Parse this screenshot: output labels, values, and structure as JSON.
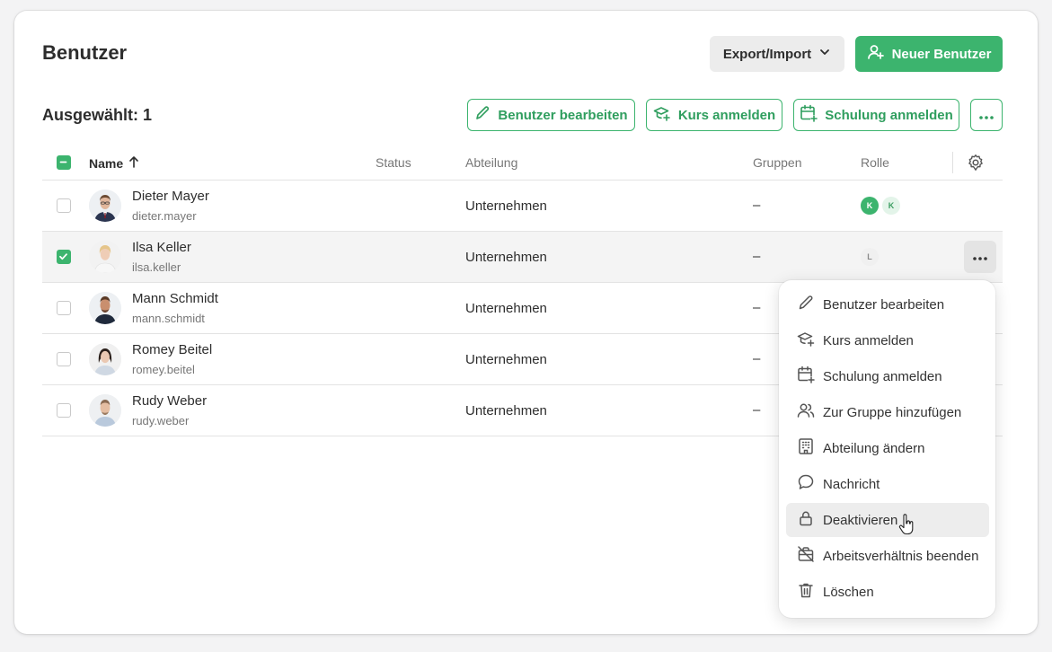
{
  "page": {
    "title": "Benutzer"
  },
  "toolbar": {
    "export_import": "Export/Import",
    "new_user": "Neuer Benutzer"
  },
  "selection": {
    "label": "Ausgewählt: 1",
    "actions": {
      "edit_user": "Benutzer bearbeiten",
      "enroll_course": "Kurs anmelden",
      "enroll_training": "Schulung anmelden"
    }
  },
  "table": {
    "columns": {
      "name": "Name",
      "status": "Status",
      "department": "Abteilung",
      "groups": "Gruppen",
      "role": "Rolle"
    },
    "rows": [
      {
        "name": "Dieter Mayer",
        "login": "dieter.mayer",
        "department": "Unternehmen",
        "groups": "–",
        "roles": [
          "K",
          "K"
        ],
        "selected": false
      },
      {
        "name": "Ilsa Keller",
        "login": "ilsa.keller",
        "department": "Unternehmen",
        "groups": "–",
        "roles": [
          "L"
        ],
        "selected": true
      },
      {
        "name": "Mann Schmidt",
        "login": "mann.schmidt",
        "department": "Unternehmen",
        "groups": "–",
        "roles": [],
        "selected": false
      },
      {
        "name": "Romey Beitel",
        "login": "romey.beitel",
        "department": "Unternehmen",
        "groups": "–",
        "roles": [],
        "selected": false
      },
      {
        "name": "Rudy Weber",
        "login": "rudy.weber",
        "department": "Unternehmen",
        "groups": "–",
        "roles": [],
        "selected": false
      }
    ]
  },
  "context_menu": {
    "items": [
      {
        "label": "Benutzer bearbeiten",
        "icon": "pencil-icon"
      },
      {
        "label": "Kurs anmelden",
        "icon": "graduation-cap-plus-icon"
      },
      {
        "label": "Schulung anmelden",
        "icon": "calendar-plus-icon"
      },
      {
        "label": "Zur Gruppe hinzufügen",
        "icon": "users-icon"
      },
      {
        "label": "Abteilung ändern",
        "icon": "building-icon"
      },
      {
        "label": "Nachricht",
        "icon": "chat-bubble-icon"
      },
      {
        "label": "Deaktivieren",
        "icon": "lock-icon"
      },
      {
        "label": "Arbeitsverhältnis beenden",
        "icon": "briefcase-off-icon"
      },
      {
        "label": "Löschen",
        "icon": "trash-icon"
      }
    ],
    "hovered_index": 6
  },
  "colors": {
    "accent": "#3cb46e",
    "accent_dark": "#2f9e5e",
    "text": "#2d2d2d",
    "muted": "#777777"
  }
}
